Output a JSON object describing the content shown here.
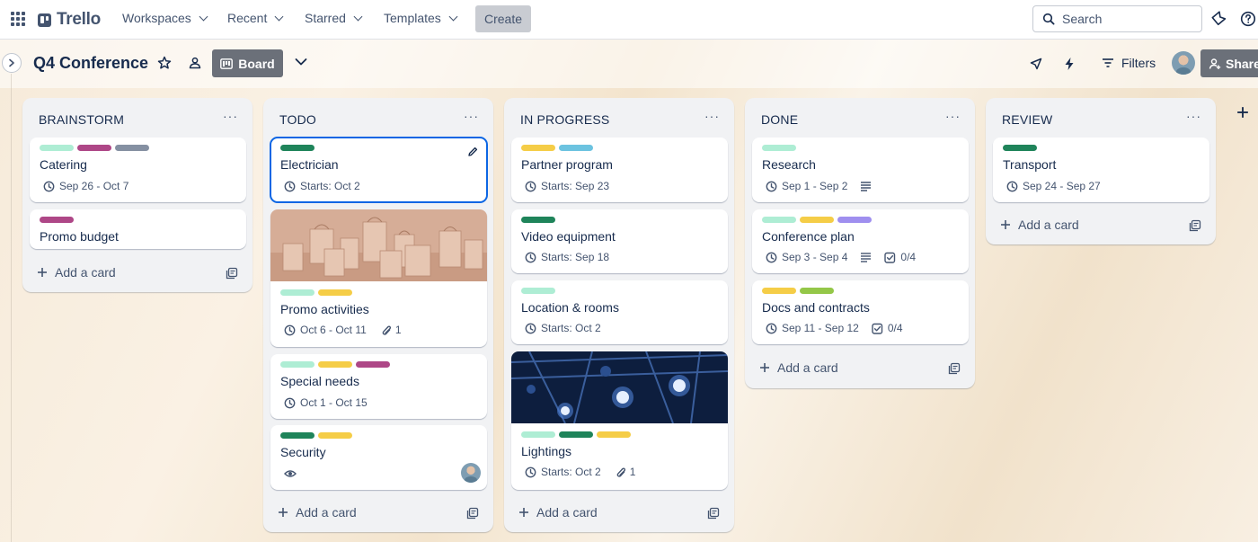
{
  "topnav": {
    "logo": "Trello",
    "menus": [
      {
        "label": "Workspaces"
      },
      {
        "label": "Recent"
      },
      {
        "label": "Starred"
      },
      {
        "label": "Templates"
      }
    ],
    "create_label": "Create",
    "search_placeholder": "Search"
  },
  "board": {
    "title": "Q4 Conference",
    "view_label": "Board",
    "filters_label": "Filters",
    "share_label": "Share"
  },
  "colors": {
    "green_light": "#aeedd4",
    "green": "#1f845a",
    "magenta": "#ae4787",
    "gray": "#8590a2",
    "yellow": "#f5cd47",
    "sky": "#6cc3e0",
    "purple": "#9f8fef",
    "lime": "#94c748",
    "selected_border": "#0c66e4"
  },
  "add_card_label": "Add a card",
  "lists": [
    {
      "title": "BRAINSTORM",
      "cards": [
        {
          "title": "Catering",
          "labels": [
            "green_light",
            "magenta",
            "gray"
          ],
          "date": "Sep 26 - Oct 7"
        },
        {
          "title": "Promo budget",
          "labels": [
            "magenta"
          ]
        }
      ]
    },
    {
      "title": "TODO",
      "cards": [
        {
          "title": "Electrician",
          "labels": [
            "green"
          ],
          "date": "Starts: Oct 2",
          "selected": true,
          "edit_icon": "pencil-icon"
        },
        {
          "title": "Promo activities",
          "cover": "shopping-bags-image",
          "labels": [
            "green_light",
            "yellow"
          ],
          "date": "Oct 6 - Oct 11",
          "attachments": "1"
        },
        {
          "title": "Special needs",
          "labels": [
            "green_light",
            "yellow",
            "magenta"
          ],
          "date": "Oct 1 - Oct 15"
        },
        {
          "title": "Security",
          "labels": [
            "green",
            "yellow"
          ],
          "watching": true,
          "member": "avatar"
        }
      ]
    },
    {
      "title": "IN PROGRESS",
      "cards": [
        {
          "title": "Partner program",
          "labels": [
            "yellow",
            "sky"
          ],
          "date": "Starts: Sep 23"
        },
        {
          "title": "Video equipment",
          "labels": [
            "green"
          ],
          "date": "Starts: Sep 18"
        },
        {
          "title": "Location & rooms",
          "labels": [
            "green_light"
          ],
          "date": "Starts: Oct 2"
        },
        {
          "title": "Lightings",
          "cover": "stage-lights-image",
          "labels": [
            "green_light",
            "green",
            "yellow"
          ],
          "date": "Starts: Oct 2",
          "attachments": "1"
        }
      ]
    },
    {
      "title": "DONE",
      "cards": [
        {
          "title": "Research",
          "labels": [
            "green_light"
          ],
          "date": "Sep 1 - Sep 2",
          "description": true
        },
        {
          "title": "Conference plan",
          "labels": [
            "green_light",
            "yellow",
            "purple"
          ],
          "date": "Sep 3 - Sep 4",
          "description": true,
          "checklist": "0/4"
        },
        {
          "title": "Docs and contracts",
          "labels": [
            "yellow",
            "lime"
          ],
          "date": "Sep 11 - Sep 12",
          "checklist": "0/4"
        }
      ]
    },
    {
      "title": "REVIEW",
      "cards": [
        {
          "title": "Transport",
          "labels": [
            "green"
          ],
          "date": "Sep 24 - Sep 27"
        }
      ]
    }
  ]
}
